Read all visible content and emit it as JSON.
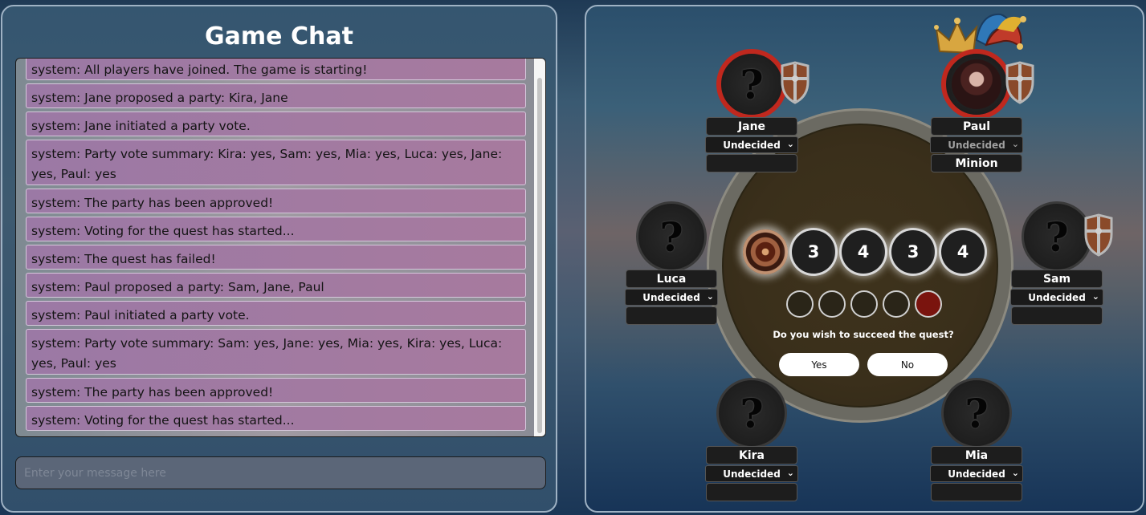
{
  "chat": {
    "title": "Game Chat",
    "messages": [
      "system: All players have joined. The game is starting!",
      "system: Jane proposed a party: Kira, Jane",
      "system: Jane initiated a party vote.",
      "system: Party vote summary: Kira: yes, Sam: yes, Mia: yes, Luca: yes, Jane: yes, Paul: yes",
      "system: The party has been approved!",
      "system: Voting for the quest has started...",
      "system: The quest has failed!",
      "system: Paul proposed a party: Sam, Jane, Paul",
      "system: Paul initiated a party vote.",
      "system: Party vote summary: Sam: yes, Jane: yes, Mia: yes, Kira: yes, Luca: yes, Paul: yes",
      "system: The party has been approved!",
      "system: Voting for the quest has started..."
    ],
    "input_placeholder": "Enter your message here"
  },
  "board": {
    "quest_sizes": [
      "3",
      "4",
      "3",
      "4"
    ],
    "vote_track": [
      "empty",
      "empty",
      "empty",
      "empty",
      "failed"
    ],
    "prompt": "Do you wish to succeed the quest?",
    "yes_label": "Yes",
    "no_label": "No",
    "unknown_symbol": "?",
    "players": [
      {
        "name": "Jane",
        "vote": "Undecided",
        "role": ""
      },
      {
        "name": "Paul",
        "vote": "Undecided",
        "role": "Minion"
      },
      {
        "name": "Luca",
        "vote": "Undecided",
        "role": ""
      },
      {
        "name": "Sam",
        "vote": "Undecided",
        "role": ""
      },
      {
        "name": "Kira",
        "vote": "Undecided",
        "role": ""
      },
      {
        "name": "Mia",
        "vote": "Undecided",
        "role": ""
      }
    ],
    "chevron": "⌄",
    "colors": {
      "leader_ring": "#c0281e",
      "failed_vote": "#7a140e"
    }
  }
}
